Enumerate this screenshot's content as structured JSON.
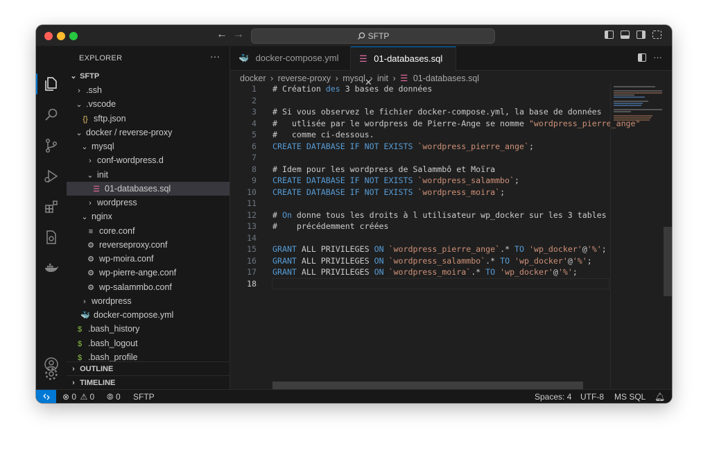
{
  "titlebar": {
    "search_text": "SFTP"
  },
  "explorer": {
    "title": "EXPLORER",
    "more": "···",
    "root": "SFTP",
    "tree": [
      {
        "label": ".ssh",
        "chevron": "›",
        "icon": "",
        "indent": 12
      },
      {
        "label": ".vscode",
        "chevron": "⌄",
        "icon": "",
        "indent": 12
      },
      {
        "label": "sftp.json",
        "chevron": "",
        "icon": "{}",
        "indent": 20
      },
      {
        "label": "docker / reverse-proxy",
        "chevron": "⌄",
        "icon": "",
        "indent": 12
      },
      {
        "label": "mysql",
        "chevron": "⌄",
        "icon": "",
        "indent": 20
      },
      {
        "label": "conf-wordpress.d",
        "chevron": "›",
        "icon": "",
        "indent": 28
      },
      {
        "label": "init",
        "chevron": "⌄",
        "icon": "",
        "indent": 28
      },
      {
        "label": "01-databases.sql",
        "chevron": "",
        "icon": "db",
        "indent": 36,
        "selected": true
      },
      {
        "label": "wordpress",
        "chevron": "›",
        "icon": "",
        "indent": 28
      },
      {
        "label": "nginx",
        "chevron": "⌄",
        "icon": "",
        "indent": 20
      },
      {
        "label": "core.conf",
        "chevron": "",
        "icon": "≡",
        "indent": 28
      },
      {
        "label": "reverseproxy.conf",
        "chevron": "",
        "icon": "⚙",
        "indent": 28
      },
      {
        "label": "wp-moira.conf",
        "chevron": "",
        "icon": "⚙",
        "indent": 28
      },
      {
        "label": "wp-pierre-ange.conf",
        "chevron": "",
        "icon": "⚙",
        "indent": 28
      },
      {
        "label": "wp-salammbo.conf",
        "chevron": "",
        "icon": "⚙",
        "indent": 28
      },
      {
        "label": "wordpress",
        "chevron": "›",
        "icon": "",
        "indent": 20
      },
      {
        "label": "docker-compose.yml",
        "chevron": "",
        "icon": "docker",
        "indent": 20
      },
      {
        "label": ".bash_history",
        "chevron": "",
        "icon": "$",
        "indent": 12
      },
      {
        "label": ".bash_logout",
        "chevron": "",
        "icon": "$",
        "indent": 12
      },
      {
        "label": ".bash_profile",
        "chevron": "",
        "icon": "$",
        "indent": 12
      }
    ],
    "outline": "OUTLINE",
    "timeline": "TIMELINE"
  },
  "tabs": [
    {
      "label": "docker-compose.yml",
      "active": false
    },
    {
      "label": "01-databases.sql",
      "active": true
    }
  ],
  "breadcrumbs": [
    "docker",
    "reverse-proxy",
    "mysql",
    "init",
    "01-databases.sql"
  ],
  "code_lines": [
    [
      [
        "c-com",
        "# Création "
      ],
      [
        "c-kw",
        "des"
      ],
      [
        "c-com",
        " 3 bases de données"
      ]
    ],
    [],
    [
      [
        "c-com",
        "# Si vous observez le fichier docker-compose.yml, la base de données"
      ]
    ],
    [
      [
        "c-com",
        "#   utlisée par le wordpress de Pierre-Ange se nomme "
      ],
      [
        "c-str",
        "\"wordpress_pierre_ange\""
      ]
    ],
    [
      [
        "c-com",
        "#   comme ci-dessous."
      ]
    ],
    [
      [
        "c-kw",
        "CREATE DATABASE IF NOT EXISTS"
      ],
      [
        "c-str",
        " `wordpress_pierre_ange`"
      ],
      [
        "c-com",
        ";"
      ]
    ],
    [],
    [
      [
        "c-com",
        "# Idem pour les wordpress de Salammbô et Moïra"
      ]
    ],
    [
      [
        "c-kw",
        "CREATE DATABASE IF NOT EXISTS"
      ],
      [
        "c-str",
        " `wordpress_salammbo`"
      ],
      [
        "c-com",
        ";"
      ]
    ],
    [
      [
        "c-kw",
        "CREATE DATABASE IF NOT EXISTS"
      ],
      [
        "c-str",
        " `wordpress_moira`"
      ],
      [
        "c-com",
        ";"
      ]
    ],
    [],
    [
      [
        "c-com",
        "# "
      ],
      [
        "c-kw",
        "On"
      ],
      [
        "c-com",
        " donne tous les droits à l utilisateur wp_docker sur les 3 tables"
      ]
    ],
    [
      [
        "c-com",
        "#    précédemment créées"
      ]
    ],
    [],
    [
      [
        "c-kw",
        "GRANT"
      ],
      [
        "c-com",
        " ALL PRIVILEGES "
      ],
      [
        "c-kw",
        "ON"
      ],
      [
        "c-str",
        " `wordpress_pierre_ange`"
      ],
      [
        "c-com",
        ".* "
      ],
      [
        "c-kw",
        "TO"
      ],
      [
        "c-str",
        " 'wp_docker'"
      ],
      [
        "c-com",
        "@"
      ],
      [
        "c-str",
        "'%'"
      ],
      [
        "c-com",
        ";"
      ]
    ],
    [
      [
        "c-kw",
        "GRANT"
      ],
      [
        "c-com",
        " ALL PRIVILEGES "
      ],
      [
        "c-kw",
        "ON"
      ],
      [
        "c-str",
        " `wordpress_salammbo`"
      ],
      [
        "c-com",
        ".* "
      ],
      [
        "c-kw",
        "TO"
      ],
      [
        "c-str",
        " 'wp_docker'"
      ],
      [
        "c-com",
        "@"
      ],
      [
        "c-str",
        "'%'"
      ],
      [
        "c-com",
        ";"
      ]
    ],
    [
      [
        "c-kw",
        "GRANT"
      ],
      [
        "c-com",
        " ALL PRIVILEGES "
      ],
      [
        "c-kw",
        "ON"
      ],
      [
        "c-str",
        " `wordpress_moira`"
      ],
      [
        "c-com",
        ".* "
      ],
      [
        "c-kw",
        "TO"
      ],
      [
        "c-str",
        " 'wp_docker'"
      ],
      [
        "c-com",
        "@"
      ],
      [
        "c-str",
        "'%'"
      ],
      [
        "c-com",
        ";"
      ]
    ],
    []
  ],
  "current_line": 18,
  "status": {
    "errors": "0",
    "warnings": "0",
    "ports": "0",
    "remote_name": "SFTP",
    "spaces": "Spaces: 4",
    "encoding": "UTF-8",
    "language": "MS SQL"
  },
  "colors": {
    "accent": "#0078d4",
    "keyword": "#569cd6",
    "string": "#ce9178",
    "sql_icon": "#e06c9f"
  }
}
